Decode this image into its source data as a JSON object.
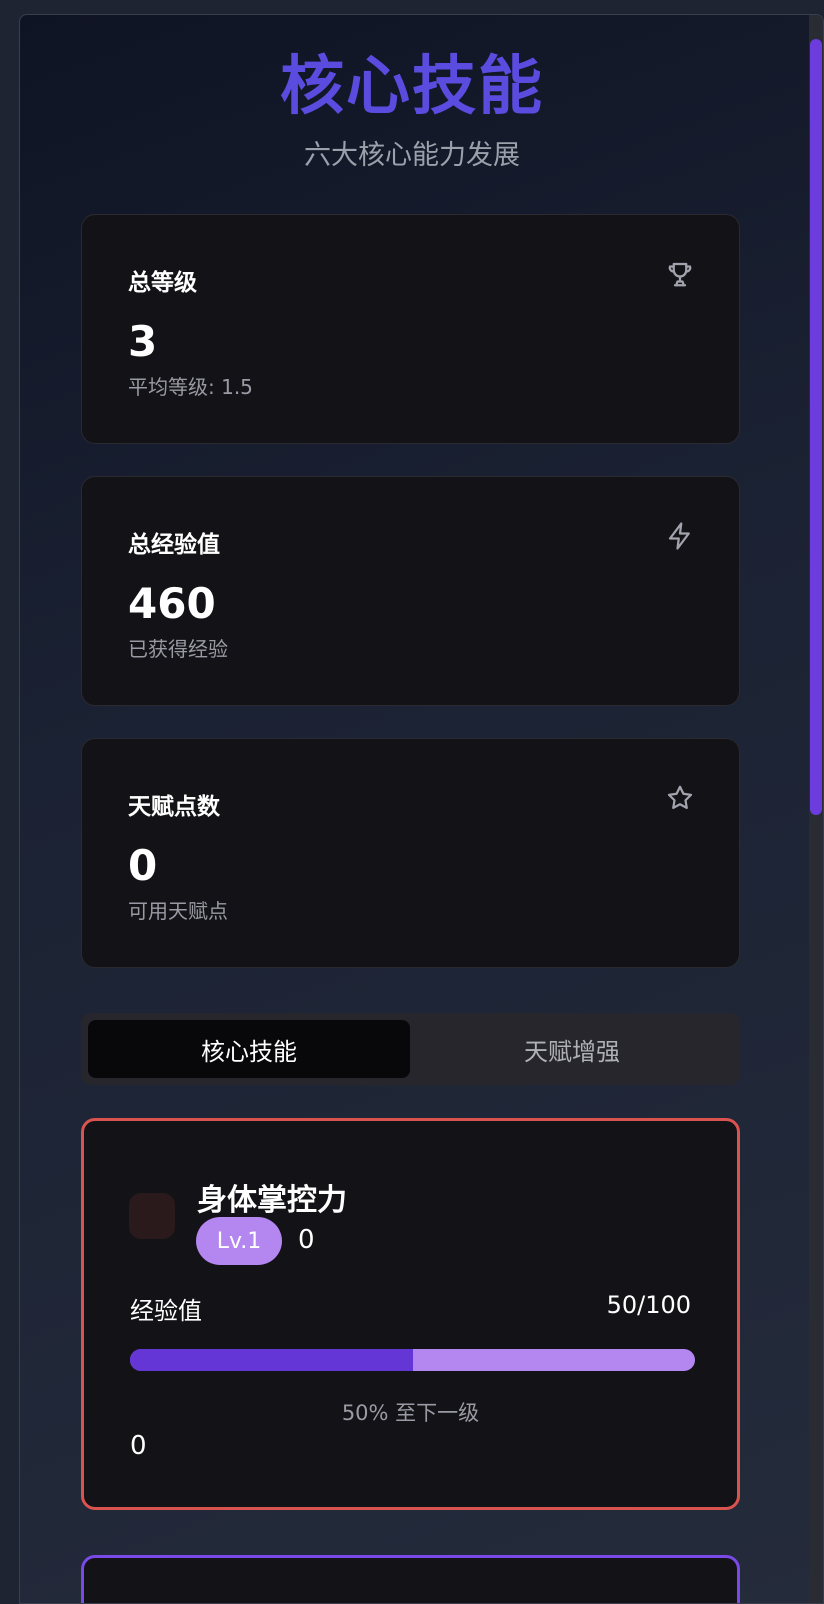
{
  "header": {
    "title": "核心技能",
    "subtitle": "六大核心能力发展"
  },
  "stats": [
    {
      "label": "总等级",
      "value": "3",
      "sub": "平均等级: 1.5",
      "icon": "trophy-icon"
    },
    {
      "label": "总经验值",
      "value": "460",
      "sub": "已获得经验",
      "icon": "lightning-icon"
    },
    {
      "label": "天赋点数",
      "value": "0",
      "sub": "可用天赋点",
      "icon": "star-icon"
    }
  ],
  "tabs": {
    "active": "核心技能",
    "inactive": "天赋增强"
  },
  "skill": {
    "name": "身体掌控力",
    "level": "Lv.1",
    "level_extra": "0",
    "exp_label": "经验值",
    "exp_value": "50/100",
    "progress": 0.5,
    "next_text": "50% 至下一级",
    "bottom_value": "0",
    "border_color": "#d9534f"
  },
  "colors": {
    "accent": "#5b4ce0",
    "progress_fill": "#6436d6",
    "progress_track": "#b486f0"
  }
}
